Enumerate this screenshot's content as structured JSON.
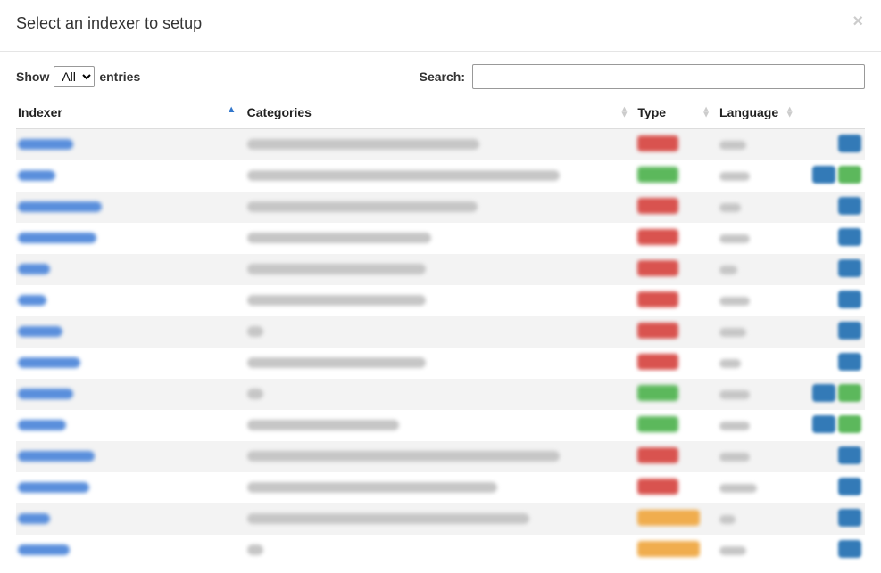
{
  "modal": {
    "title": "Select an indexer to setup",
    "close_glyph": "×"
  },
  "controls": {
    "show_label": "Show",
    "entries_label": "entries",
    "length_options": [
      "All"
    ],
    "length_selected": "All",
    "search_label": "Search:",
    "search_value": ""
  },
  "table": {
    "headers": {
      "indexer": "Indexer",
      "categories": "Categories",
      "type": "Type",
      "language": "Language"
    },
    "sort": {
      "column": "indexer",
      "dir": "asc"
    },
    "rows": [
      {
        "indexer_w": 62,
        "cat_w": 260,
        "type": "red",
        "lang_w": 30,
        "actions": [
          "blue"
        ]
      },
      {
        "indexer_w": 42,
        "cat_w": 350,
        "type": "green",
        "lang_w": 34,
        "actions": [
          "blue",
          "green"
        ]
      },
      {
        "indexer_w": 94,
        "cat_w": 258,
        "type": "red",
        "lang_w": 24,
        "actions": [
          "blue"
        ]
      },
      {
        "indexer_w": 88,
        "cat_w": 206,
        "type": "red",
        "lang_w": 34,
        "actions": [
          "blue"
        ]
      },
      {
        "indexer_w": 36,
        "cat_w": 200,
        "type": "red",
        "lang_w": 20,
        "actions": [
          "blue"
        ]
      },
      {
        "indexer_w": 32,
        "cat_w": 200,
        "type": "red",
        "lang_w": 34,
        "actions": [
          "blue"
        ]
      },
      {
        "indexer_w": 50,
        "cat_w": 18,
        "type": "red",
        "lang_w": 30,
        "actions": [
          "blue"
        ]
      },
      {
        "indexer_w": 70,
        "cat_w": 200,
        "type": "red",
        "lang_w": 24,
        "actions": [
          "blue"
        ]
      },
      {
        "indexer_w": 62,
        "cat_w": 18,
        "type": "green",
        "lang_w": 34,
        "actions": [
          "blue",
          "green"
        ]
      },
      {
        "indexer_w": 54,
        "cat_w": 170,
        "type": "green",
        "lang_w": 34,
        "actions": [
          "blue",
          "green"
        ]
      },
      {
        "indexer_w": 86,
        "cat_w": 350,
        "type": "red",
        "lang_w": 34,
        "actions": [
          "blue"
        ]
      },
      {
        "indexer_w": 80,
        "cat_w": 280,
        "type": "red",
        "lang_w": 42,
        "actions": [
          "blue"
        ]
      },
      {
        "indexer_w": 36,
        "cat_w": 316,
        "type": "orange",
        "lang_w": 18,
        "actions": [
          "blue"
        ]
      },
      {
        "indexer_w": 58,
        "cat_w": 18,
        "type": "orange",
        "lang_w": 30,
        "actions": [
          "blue"
        ]
      }
    ]
  }
}
